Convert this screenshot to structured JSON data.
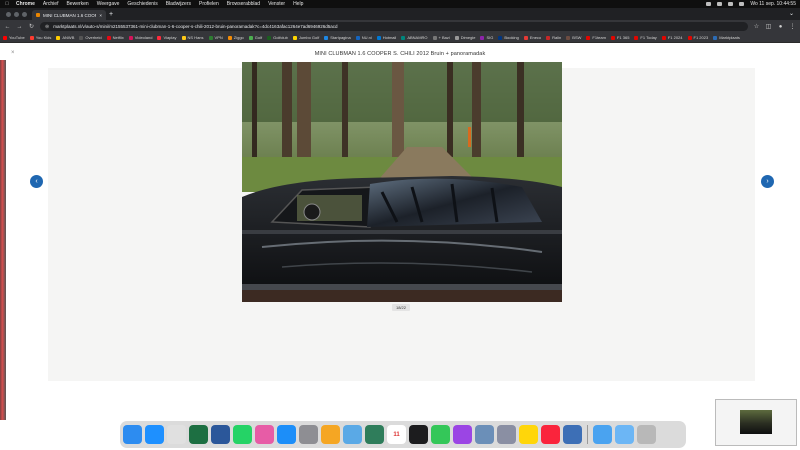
{
  "menubar": {
    "items": [
      "Chrome",
      "Archief",
      "Bewerken",
      "Weergave",
      "Geschiedenis",
      "Bladwijzers",
      "Profielen",
      "Browserabblad",
      "Venster",
      "Help"
    ],
    "clock": "Wo 11 sep. 10:44:55"
  },
  "browser": {
    "tab_title": "MINI CLUBMAN 1.6 COOPER...",
    "url": "marktplaats.nl/v/auto-s/mini/m2155537361-mini-clubman-1-6-cooper-s-chili-2012-bruin-panoramadak?c=4dc4163afac1264e7ad6946926d5acd",
    "bookmarks": [
      {
        "label": "YouTube",
        "color": "#ff0000"
      },
      {
        "label": "You Kids",
        "color": "#ff3b30"
      },
      {
        "label": "ANWB",
        "color": "#ffcc00"
      },
      {
        "label": "Overheid",
        "color": "#555555"
      },
      {
        "label": "Netflix",
        "color": "#e50914"
      },
      {
        "label": "Videoland",
        "color": "#d4145a"
      },
      {
        "label": "Viaplay",
        "color": "#ff2a3c"
      },
      {
        "label": "NS Hans",
        "color": "#ffc917"
      },
      {
        "label": "VPN",
        "color": "#2e7d32"
      },
      {
        "label": "Ziggo",
        "color": "#f48c06"
      },
      {
        "label": "Golf",
        "color": "#4caf50"
      },
      {
        "label": "Golfclub",
        "color": "#1b5e20"
      },
      {
        "label": "Jumbo Golf",
        "color": "#ffd600"
      },
      {
        "label": "Startpagina",
        "color": "#1e88e5"
      },
      {
        "label": "NU.nl",
        "color": "#1565c0"
      },
      {
        "label": "Hotmail",
        "color": "#0078d4"
      },
      {
        "label": "ABNAMRO",
        "color": "#00857c"
      },
      {
        "label": "+ Bazi",
        "color": "#777777"
      },
      {
        "label": "Dimegie",
        "color": "#999999"
      },
      {
        "label": "SIG",
        "color": "#8e24aa"
      },
      {
        "label": "Booking",
        "color": "#003580"
      },
      {
        "label": "Eneco",
        "color": "#e53935"
      },
      {
        "label": "Ralin",
        "color": "#c62828"
      },
      {
        "label": "BSW",
        "color": "#6d4c41"
      },
      {
        "label": "F1team",
        "color": "#e10600"
      },
      {
        "label": "F1 365",
        "color": "#e10600"
      },
      {
        "label": "F1 Today",
        "color": "#e10600"
      },
      {
        "label": "F1 2024",
        "color": "#e10600"
      },
      {
        "label": "F1 2023",
        "color": "#e10600"
      },
      {
        "label": "Marktplaats",
        "color": "#2c6cb5"
      }
    ]
  },
  "page": {
    "title": "MINI CLUBMAN 1.6 COOPER S. CHILI 2012 Bruin + panoramadak",
    "counter": "18/22",
    "prev_label": "‹",
    "next_label": "›",
    "close_label": "×"
  },
  "dock": {
    "apps": [
      {
        "name": "finder-icon",
        "color": "#2d8cf0"
      },
      {
        "name": "safari-icon",
        "color": "#1e90ff"
      },
      {
        "name": "chrome-icon",
        "color": "#e0e0e0"
      },
      {
        "name": "excel-icon",
        "color": "#1d6f42"
      },
      {
        "name": "word-icon",
        "color": "#2b579a"
      },
      {
        "name": "whatsapp-icon",
        "color": "#25d366"
      },
      {
        "name": "screens-icon",
        "color": "#e75ca6"
      },
      {
        "name": "app-store-icon",
        "color": "#1c8ef9"
      },
      {
        "name": "system-settings-icon",
        "color": "#8e8e93"
      },
      {
        "name": "photos-icon",
        "color": "#f5a623"
      },
      {
        "name": "preview-icon",
        "color": "#5aa9e6"
      },
      {
        "name": "time-machine-icon",
        "color": "#2f7d5b"
      },
      {
        "name": "calendar-icon",
        "color": "#ffffff"
      },
      {
        "name": "clock-icon",
        "color": "#1c1c1e"
      },
      {
        "name": "facetime-icon",
        "color": "#34c759"
      },
      {
        "name": "podcasts-icon",
        "color": "#9b45e4"
      },
      {
        "name": "image-capture-icon",
        "color": "#6b8fb8"
      },
      {
        "name": "launchpad-icon",
        "color": "#8a8fa3"
      },
      {
        "name": "notes-icon",
        "color": "#ffd60a"
      },
      {
        "name": "music-icon",
        "color": "#fa243c"
      },
      {
        "name": "control-center-icon",
        "color": "#3d6fb6"
      },
      {
        "name": "downloads-folder-icon",
        "color": "#4aa3f0"
      },
      {
        "name": "applications-folder-icon",
        "color": "#6cb6f5"
      },
      {
        "name": "trash-icon",
        "color": "#b8b8b8"
      }
    ],
    "calendar_day": "11"
  }
}
